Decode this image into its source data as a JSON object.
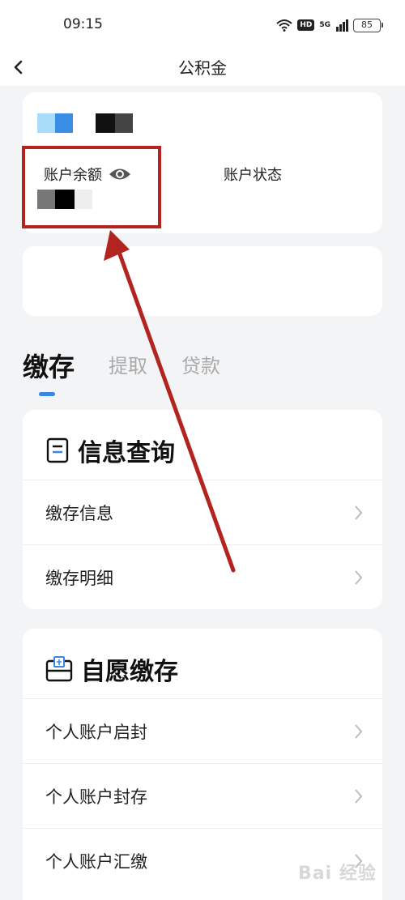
{
  "status_bar": {
    "time": "09:15",
    "hd": "HD",
    "signal": "5G",
    "battery": "85"
  },
  "nav": {
    "title": "公积金"
  },
  "account": {
    "balance_label": "账户余额",
    "status_label": "账户状态"
  },
  "tabs": [
    {
      "label": "缴存",
      "active": true
    },
    {
      "label": "提取",
      "active": false
    },
    {
      "label": "贷款",
      "active": false
    }
  ],
  "info_query": {
    "title": "信息查询",
    "items": [
      {
        "label": "缴存信息"
      },
      {
        "label": "缴存明细"
      }
    ]
  },
  "voluntary": {
    "title": "自愿缴存",
    "items": [
      {
        "label": "个人账户启封"
      },
      {
        "label": "个人账户封存"
      },
      {
        "label": "个人账户汇缴"
      }
    ]
  },
  "watermark": "Bai 经验",
  "colors": {
    "highlight": "#b3231f",
    "accent": "#3a86e0"
  }
}
